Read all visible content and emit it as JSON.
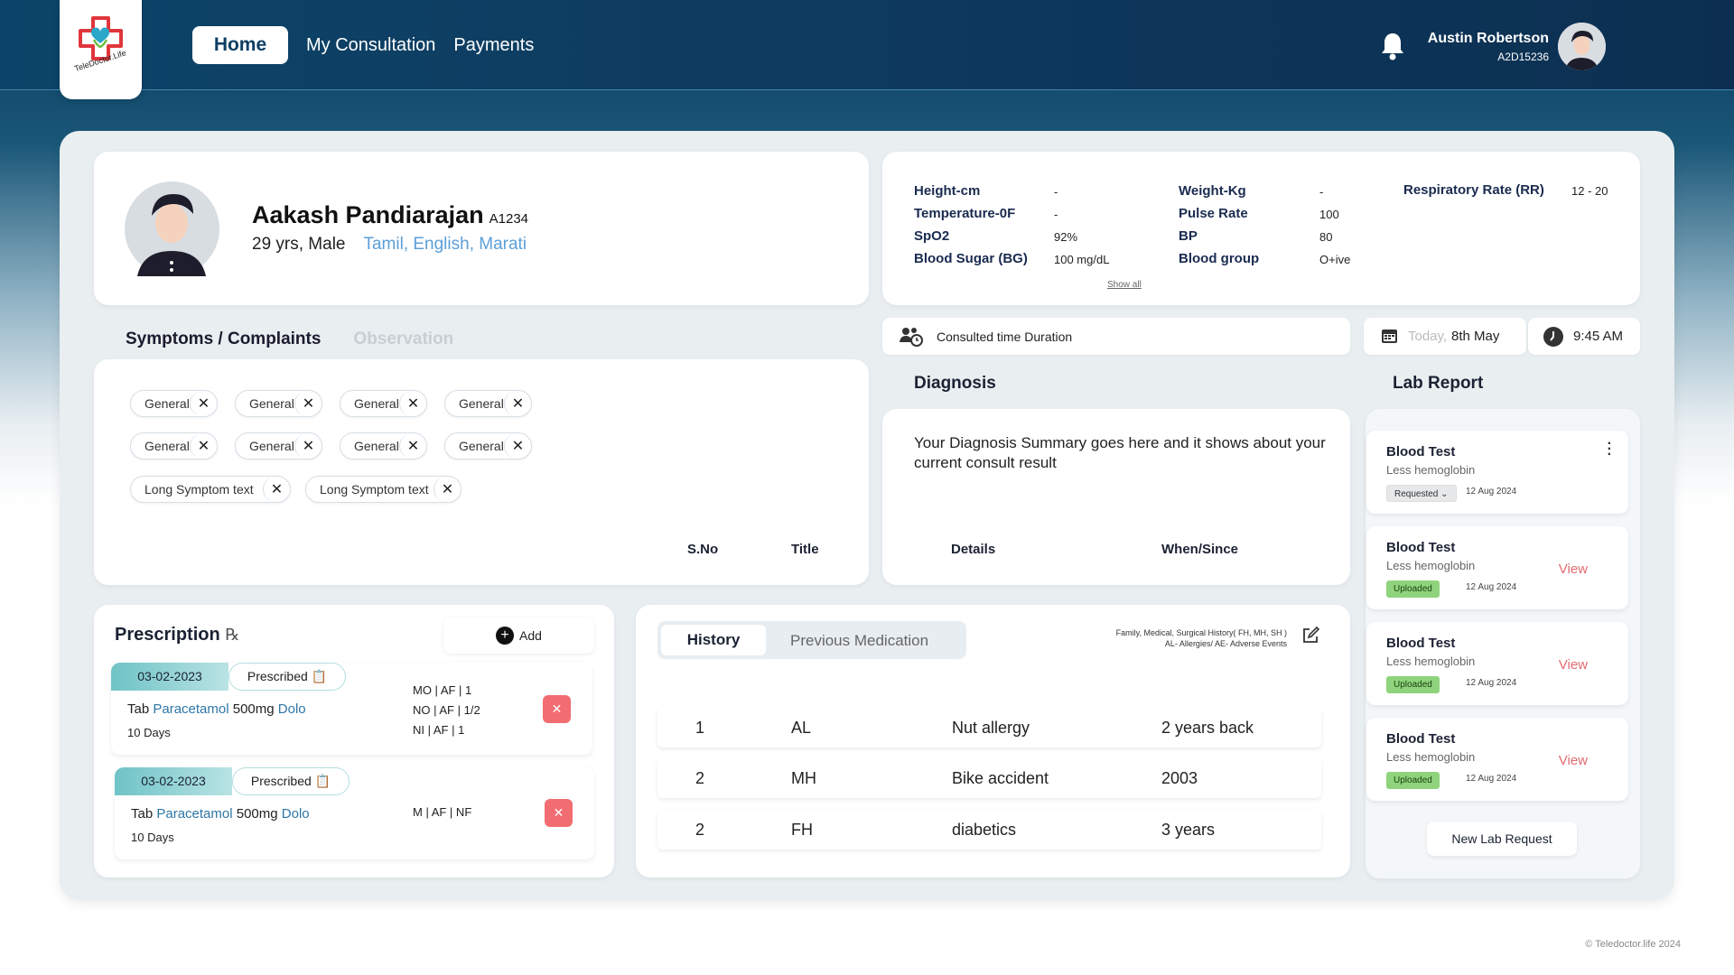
{
  "nav": {
    "home": "Home",
    "consultation": "My Consultation",
    "payments": "Payments"
  },
  "user": {
    "name": "Austin Robertson",
    "id": "A2D15236"
  },
  "patient": {
    "name": "Aakash Pandiarajan",
    "code": "A1234",
    "age_gender": "29 yrs, Male",
    "languages": "Tamil, English, Marati"
  },
  "vitals": {
    "col1": [
      {
        "label": "Height-cm",
        "value": "-"
      },
      {
        "label": "Temperature-0F",
        "value": "-"
      },
      {
        "label": "SpO2",
        "value": "92%"
      },
      {
        "label": "Blood Sugar (BG)",
        "value": "100 mg/dL"
      }
    ],
    "col2": [
      {
        "label": "Weight-Kg",
        "value": "-"
      },
      {
        "label": "Pulse Rate",
        "value": "100"
      },
      {
        "label": "BP",
        "value": "80"
      },
      {
        "label": "Blood group",
        "value": "O+ive"
      }
    ],
    "col3": [
      {
        "label": "Respiratory Rate (RR)",
        "value": "12 - 20"
      }
    ],
    "show_all": "Show all"
  },
  "tabs": {
    "symptoms": "Symptoms / Complaints",
    "observation": "Observation"
  },
  "symptoms": [
    "General",
    "General",
    "General",
    "General",
    "General",
    "General",
    "General",
    "General",
    "Long Symptom text",
    "Long Symptom text"
  ],
  "consult": {
    "duration_label": "Consulted time Duration",
    "today": "Today,",
    "date": "8th May",
    "time": "9:45 AM"
  },
  "diagnosis": {
    "title": "Diagnosis",
    "summary": "Your Diagnosis Summary goes here and it shows about your current consult result"
  },
  "lab": {
    "title": "Lab Report",
    "new_request": "New Lab Request",
    "items": [
      {
        "name": "Blood Test",
        "note": "Less hemoglobin",
        "status": "Requested ⌄",
        "date": "12 Aug 2024",
        "action": ""
      },
      {
        "name": "Blood Test",
        "note": "Less hemoglobin",
        "status": "Uploaded",
        "date": "12 Aug 2024",
        "action": "View"
      },
      {
        "name": "Blood Test",
        "note": "Less hemoglobin",
        "status": "Uploaded",
        "date": "12 Aug 2024",
        "action": "View"
      },
      {
        "name": "Blood Test",
        "note": "Less hemoglobin",
        "status": "Uploaded",
        "date": "12 Aug 2024",
        "action": "View"
      }
    ]
  },
  "prescription": {
    "title": "Prescription",
    "rx_symbol": "℞",
    "add": "Add",
    "items": [
      {
        "date": "03-02-2023",
        "status": "Prescribed",
        "prefix": "Tab",
        "drug": "Paracetamol",
        "dose": "500mg",
        "brand": "Dolo",
        "days": "10 Days",
        "schedule": [
          "MO | AF | 1",
          "NO | AF | 1/2",
          "NI | AF | 1"
        ]
      },
      {
        "date": "03-02-2023",
        "status": "Prescribed",
        "prefix": "Tab",
        "drug": "Paracetamol",
        "dose": "500mg",
        "brand": "Dolo",
        "days": "10 Days",
        "schedule": [
          "M | AF | NF"
        ]
      }
    ]
  },
  "history": {
    "tab_history": "History",
    "tab_prev": "Previous Medication",
    "legend1": "Family, Medical, Surgical History( FH, MH, SH )",
    "legend2": "AL- Allergies/ AE- Adverse Events",
    "columns": [
      "S.No",
      "Title",
      "Details",
      "When/Since"
    ],
    "rows": [
      [
        "1",
        "AL",
        "Nut allergy",
        "2 years back"
      ],
      [
        "2",
        "MH",
        "Bike accident",
        "2003"
      ],
      [
        "2",
        "FH",
        "diabetics",
        "3 years"
      ]
    ]
  },
  "footer": "© Teledoctor.life 2024"
}
